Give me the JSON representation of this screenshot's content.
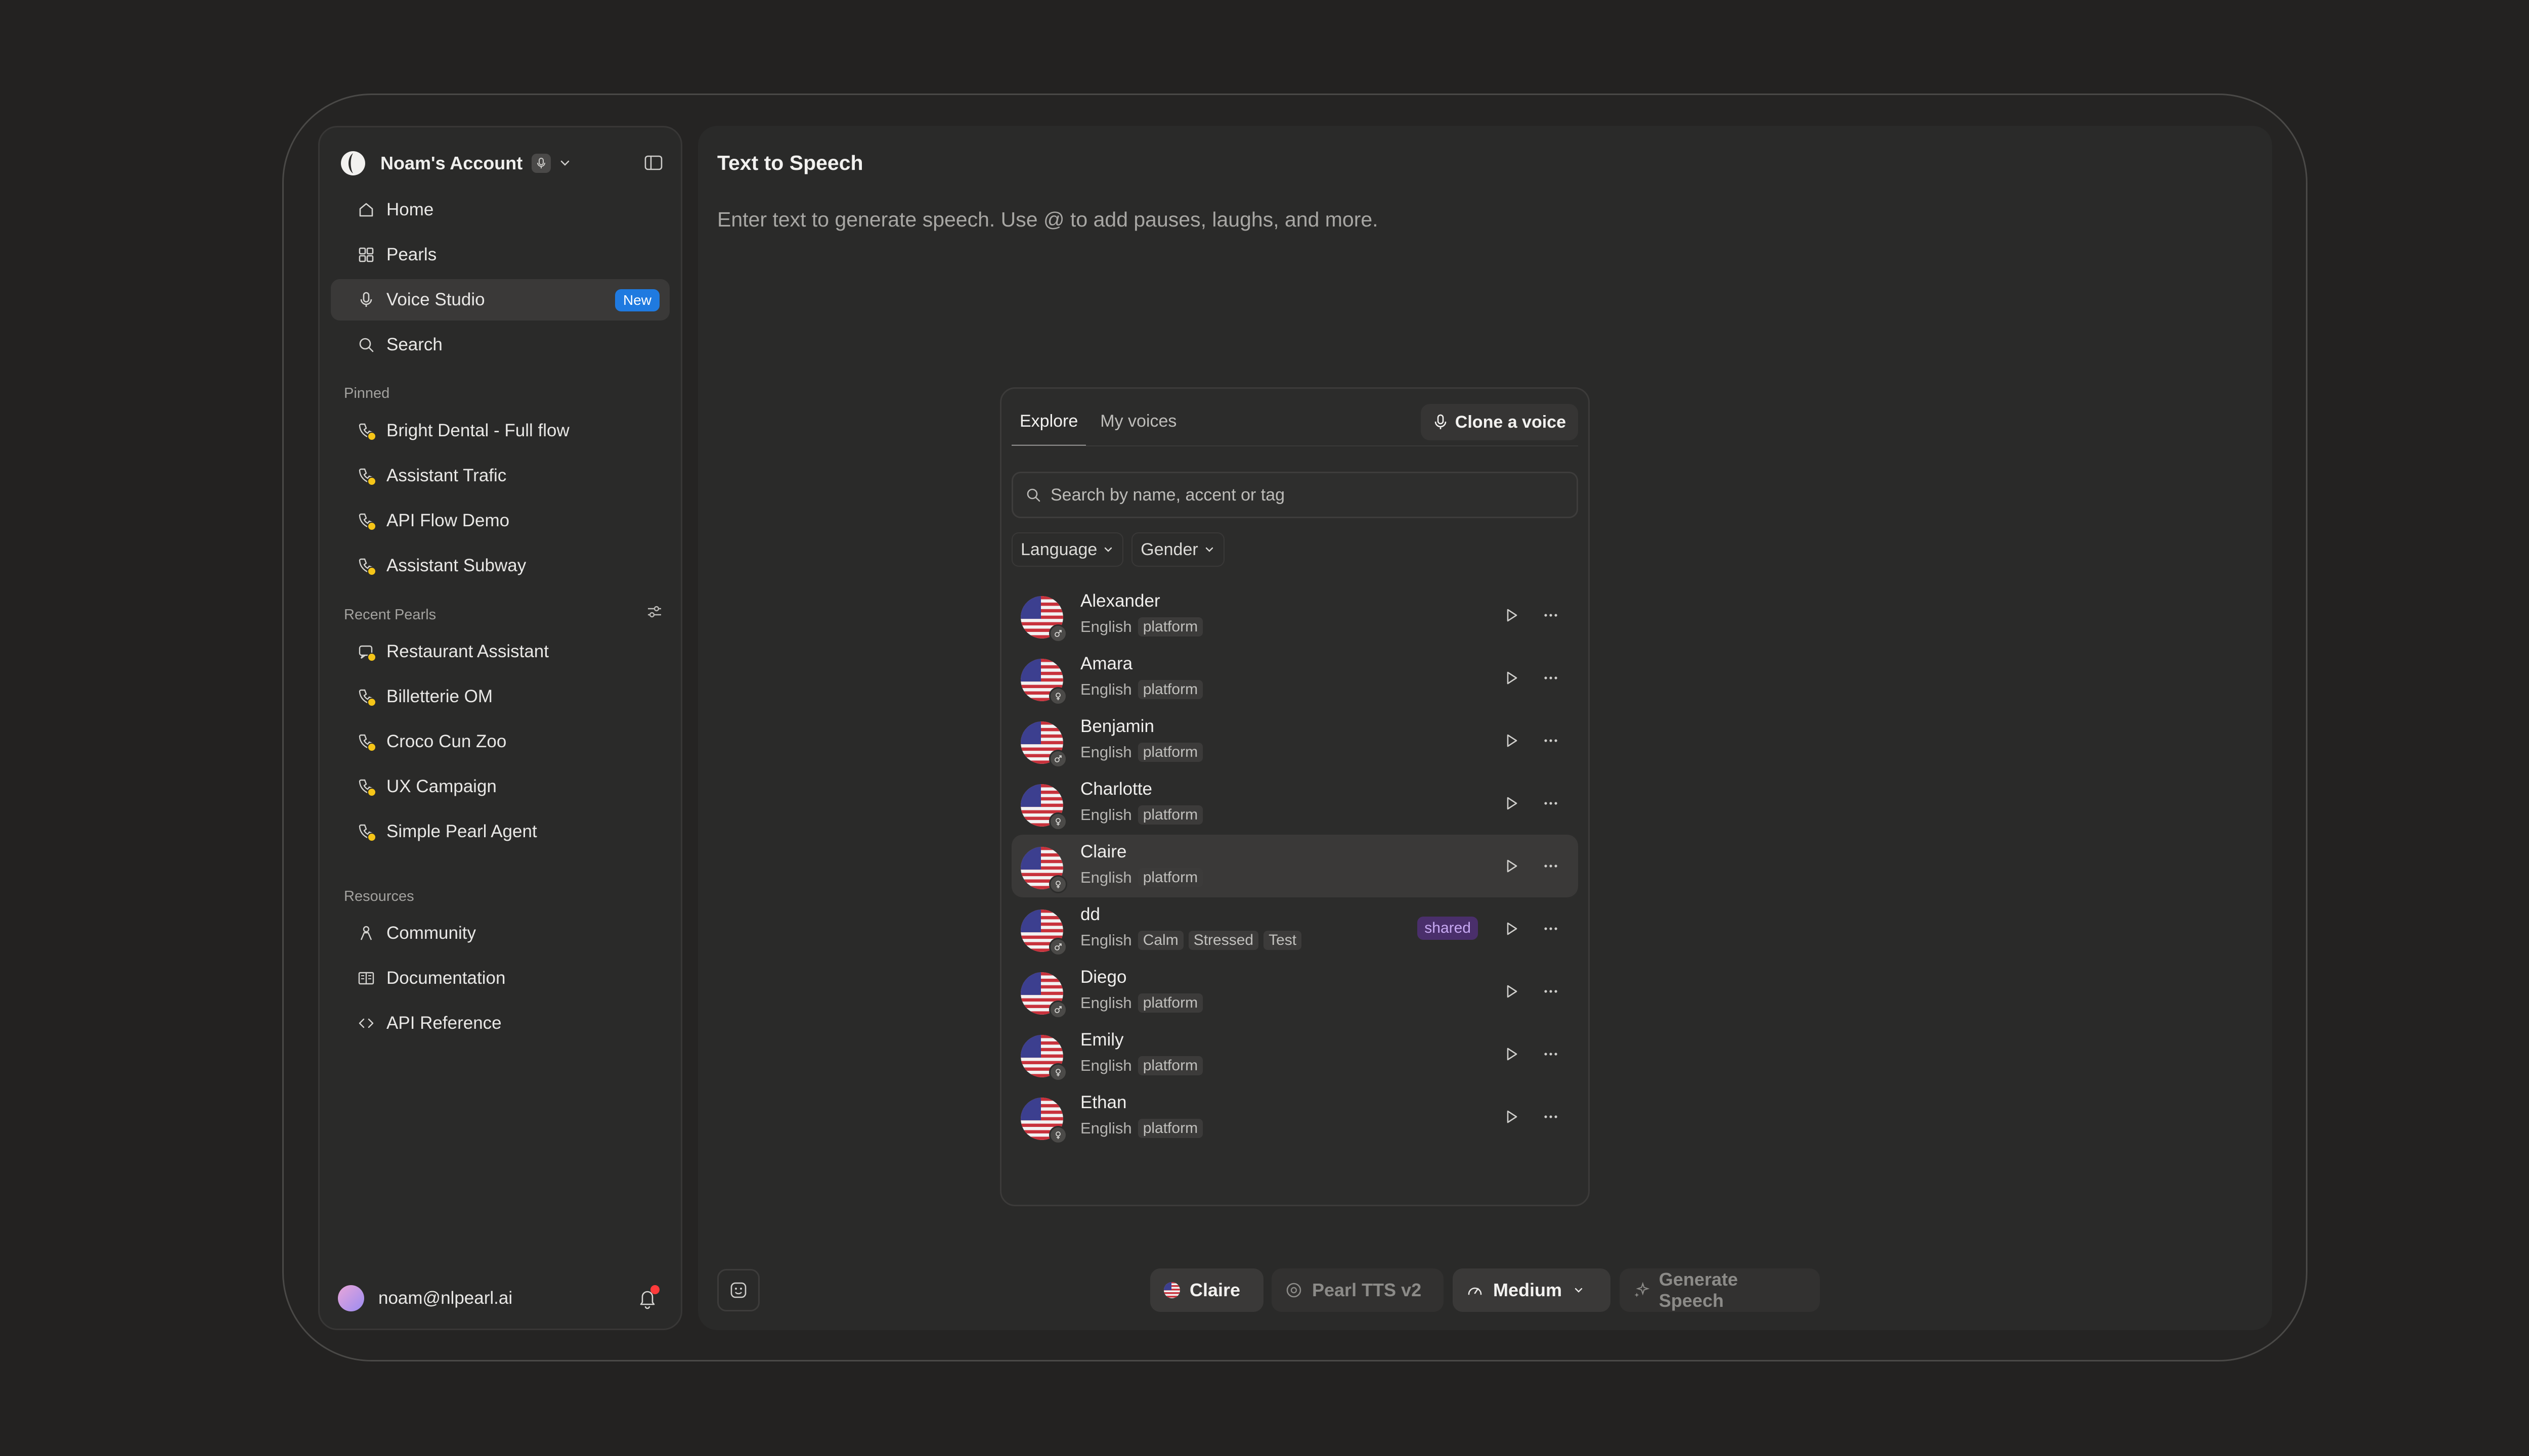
{
  "sidebar": {
    "account": {
      "name": "Noam's Account"
    },
    "nav": [
      {
        "label": "Home",
        "icon": "home-icon"
      },
      {
        "label": "Pearls",
        "icon": "grid-icon"
      },
      {
        "label": "Voice Studio",
        "icon": "mic-icon",
        "badge": "New",
        "active": true
      },
      {
        "label": "Search",
        "icon": "search-icon"
      }
    ],
    "pinned_label": "Pinned",
    "pinned": [
      {
        "label": "Bright Dental - Full flow"
      },
      {
        "label": "Assistant Trafic"
      },
      {
        "label": "API Flow Demo"
      },
      {
        "label": "Assistant Subway"
      }
    ],
    "recent_label": "Recent Pearls",
    "recent": [
      {
        "label": "Restaurant Assistant"
      },
      {
        "label": "Billetterie OM"
      },
      {
        "label": "Croco Cun Zoo"
      },
      {
        "label": "UX Campaign"
      },
      {
        "label": "Simple Pearl Agent"
      }
    ],
    "resources_label": "Resources",
    "resources": [
      {
        "label": "Community",
        "icon": "community-icon"
      },
      {
        "label": "Documentation",
        "icon": "book-icon"
      },
      {
        "label": "API Reference",
        "icon": "code-icon"
      }
    ],
    "user": {
      "email": "noam@nlpearl.ai"
    }
  },
  "main": {
    "title": "Text to Speech",
    "prompt": "Enter text to generate speech. Use @ to add pauses, laughs, and more."
  },
  "voice_panel": {
    "tabs": [
      {
        "label": "Explore",
        "active": true
      },
      {
        "label": "My voices"
      }
    ],
    "clone_label": "Clone a voice",
    "search_placeholder": "Search by name, accent or tag",
    "filters": [
      {
        "label": "Language"
      },
      {
        "label": "Gender"
      }
    ],
    "voices": [
      {
        "name": "Alexander",
        "lang": "English",
        "tags": [
          "platform"
        ],
        "gender": "male"
      },
      {
        "name": "Amara",
        "lang": "English",
        "tags": [
          "platform"
        ],
        "gender": "female"
      },
      {
        "name": "Benjamin",
        "lang": "English",
        "tags": [
          "platform"
        ],
        "gender": "male"
      },
      {
        "name": "Charlotte",
        "lang": "English",
        "tags": [
          "platform"
        ],
        "gender": "female"
      },
      {
        "name": "Claire",
        "lang": "English",
        "tags": [
          "platform"
        ],
        "gender": "female",
        "selected": true
      },
      {
        "name": "dd",
        "lang": "English",
        "tags": [
          "Calm",
          "Stressed",
          "Test"
        ],
        "gender": "male",
        "badge": "shared"
      },
      {
        "name": "Diego",
        "lang": "English",
        "tags": [
          "platform"
        ],
        "gender": "male"
      },
      {
        "name": "Emily",
        "lang": "English",
        "tags": [
          "platform"
        ],
        "gender": "female"
      },
      {
        "name": "Ethan",
        "lang": "English",
        "tags": [
          "platform"
        ],
        "gender": "female"
      }
    ]
  },
  "bottom_bar": {
    "voice_label": "Claire",
    "model_label": "Pearl TTS v2",
    "speed_label": "Medium",
    "generate_label": "Generate Speech"
  },
  "colors": {
    "accent": "#1f7ae0",
    "pin_dot": "#f5c518",
    "shared_bg": "#4a2f6b",
    "shared_text": "#c8a9f3",
    "notify": "#ff3b3b"
  }
}
